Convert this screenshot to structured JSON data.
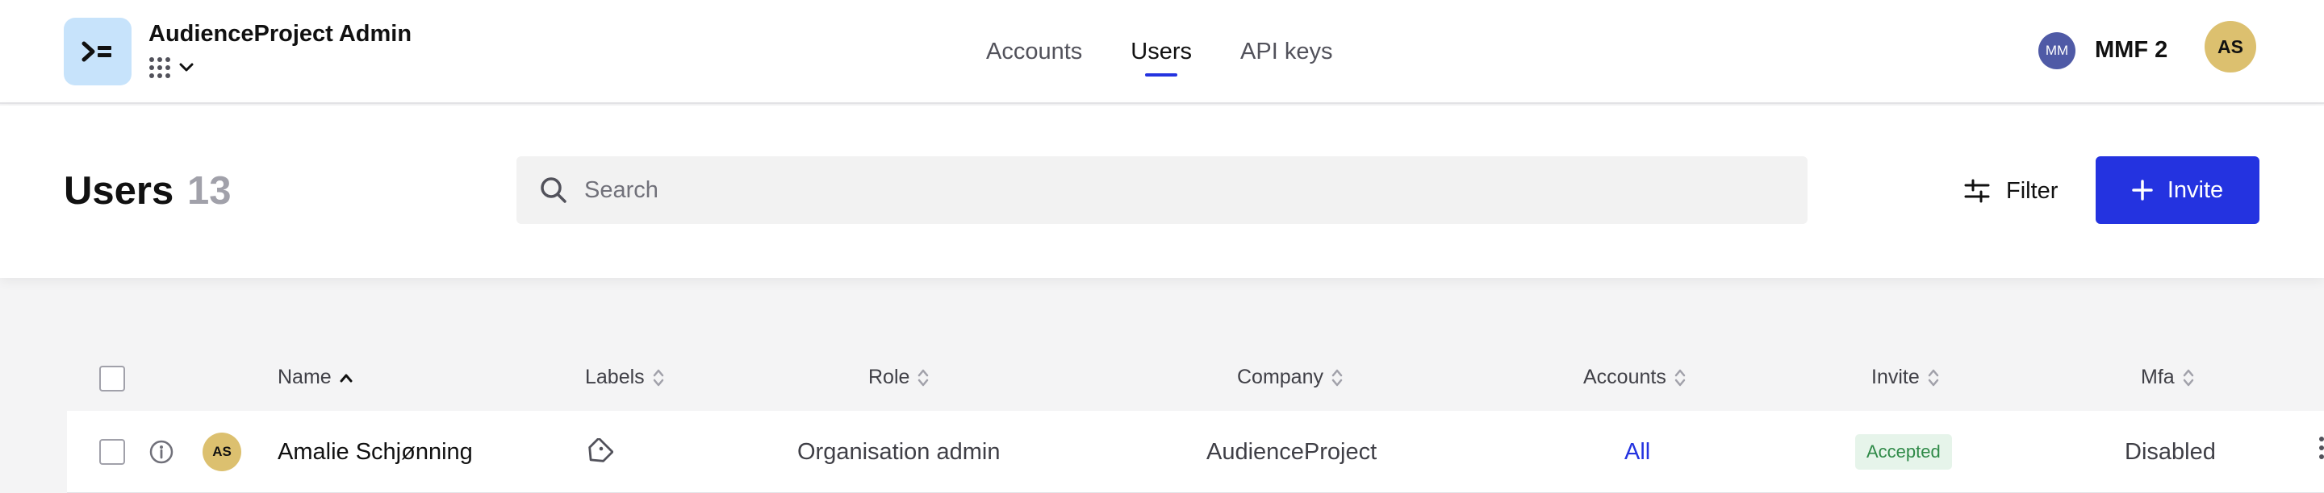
{
  "app": {
    "title": "AudienceProject Admin",
    "logo_icon": "audienceproject-logo-icon",
    "switcher_icon": "grid-apps-icon"
  },
  "nav": {
    "tabs": [
      {
        "label": "Accounts",
        "active": false
      },
      {
        "label": "Users",
        "active": true
      },
      {
        "label": "API keys",
        "active": false
      }
    ]
  },
  "org": {
    "badge": "MM",
    "name": "MMF 2"
  },
  "current_user": {
    "initials": "AS"
  },
  "page": {
    "title": "Users",
    "count": "13"
  },
  "search": {
    "placeholder": "Search",
    "value": ""
  },
  "toolbar": {
    "filter_label": "Filter",
    "invite_label": "Invite"
  },
  "table": {
    "columns": [
      {
        "key": "name",
        "label": "Name",
        "sort": "ascending"
      },
      {
        "key": "labels",
        "label": "Labels",
        "sort": "none"
      },
      {
        "key": "role",
        "label": "Role",
        "sort": "none"
      },
      {
        "key": "company",
        "label": "Company",
        "sort": "none"
      },
      {
        "key": "accounts",
        "label": "Accounts",
        "sort": "none"
      },
      {
        "key": "invite",
        "label": "Invite",
        "sort": "none"
      },
      {
        "key": "mfa",
        "label": "Mfa",
        "sort": "none"
      }
    ],
    "rows": [
      {
        "initials": "AS",
        "name": "Amalie Schjønning",
        "labels_icon": "tag-icon",
        "role": "Organisation admin",
        "company": "AudienceProject",
        "accounts": "All",
        "invite": "Accepted",
        "mfa": "Disabled"
      }
    ]
  },
  "colors": {
    "primary": "#2433e0",
    "accepted_bg": "#e6f4ea",
    "accepted_text": "#2f8a48",
    "avatar": "#dcc06f",
    "org_badge": "#4f5aa6",
    "logo_bg": "#c7e3fb"
  }
}
